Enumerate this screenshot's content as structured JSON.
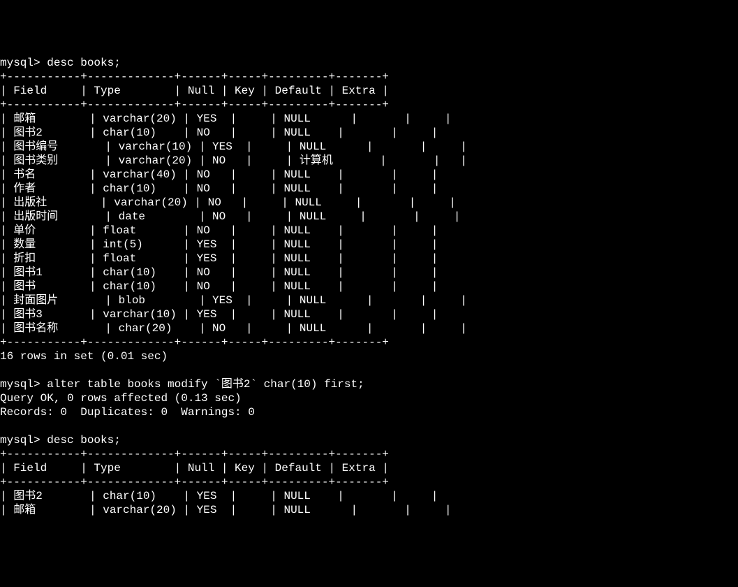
{
  "prompt": "mysql>",
  "cmd_desc": "desc books;",
  "cmd_alter": "alter table books modify `图书2` char(10) first;",
  "result_rows": "16 rows in set (0.01 sec)",
  "result_alter_ok": "Query OK, 0 rows affected (0.13 sec)",
  "result_alter_records": "Records: 0  Duplicates: 0  Warnings: 0",
  "table1": {
    "border_top": "+-----------+-------------+------+-----+---------+-------+",
    "header": "| Field     | Type        | Null | Key | Default | Extra |",
    "border_mid": "+-----------+-------------+------+-----+---------+-------+",
    "border_bot": "+-----------+-------------+------+-----+---------+-------+",
    "rows": [
      "| 邮箱        | varchar(20) | YES  |     | NULL      |       |     |",
      "| 图书2       | char(10)    | NO   |     | NULL    |       |     |",
      "| 图书编号       | varchar(10) | YES  |     | NULL      |       |     |",
      "| 图书类别       | varchar(20) | NO   |     | 计算机       |       |   |",
      "| 书名        | varchar(40) | NO   |     | NULL    |       |     |",
      "| 作者        | char(10)    | NO   |     | NULL    |       |     |",
      "| 出版社        | varchar(20) | NO   |     | NULL     |       |     |",
      "| 出版时间       | date        | NO   |     | NULL     |       |     |",
      "| 单价        | float       | NO   |     | NULL    |       |     |",
      "| 数量        | int(5)      | YES  |     | NULL    |       |     |",
      "| 折扣        | float       | YES  |     | NULL    |       |     |",
      "| 图书1       | char(10)    | NO   |     | NULL    |       |     |",
      "| 图书        | char(10)    | NO   |     | NULL    |       |     |",
      "| 封面图片       | blob        | YES  |     | NULL      |       |     |",
      "| 图书3       | varchar(10) | YES  |     | NULL    |       |     |",
      "| 图书名称       | char(20)    | NO   |     | NULL      |       |     |"
    ]
  },
  "table2": {
    "border_top": "+-----------+-------------+------+-----+---------+-------+",
    "header": "| Field     | Type        | Null | Key | Default | Extra |",
    "border_mid": "+-----------+-------------+------+-----+---------+-------+",
    "rows": [
      "| 图书2       | char(10)    | YES  |     | NULL    |       |     |",
      "| 邮箱        | varchar(20) | YES  |     | NULL      |       |     |"
    ]
  }
}
